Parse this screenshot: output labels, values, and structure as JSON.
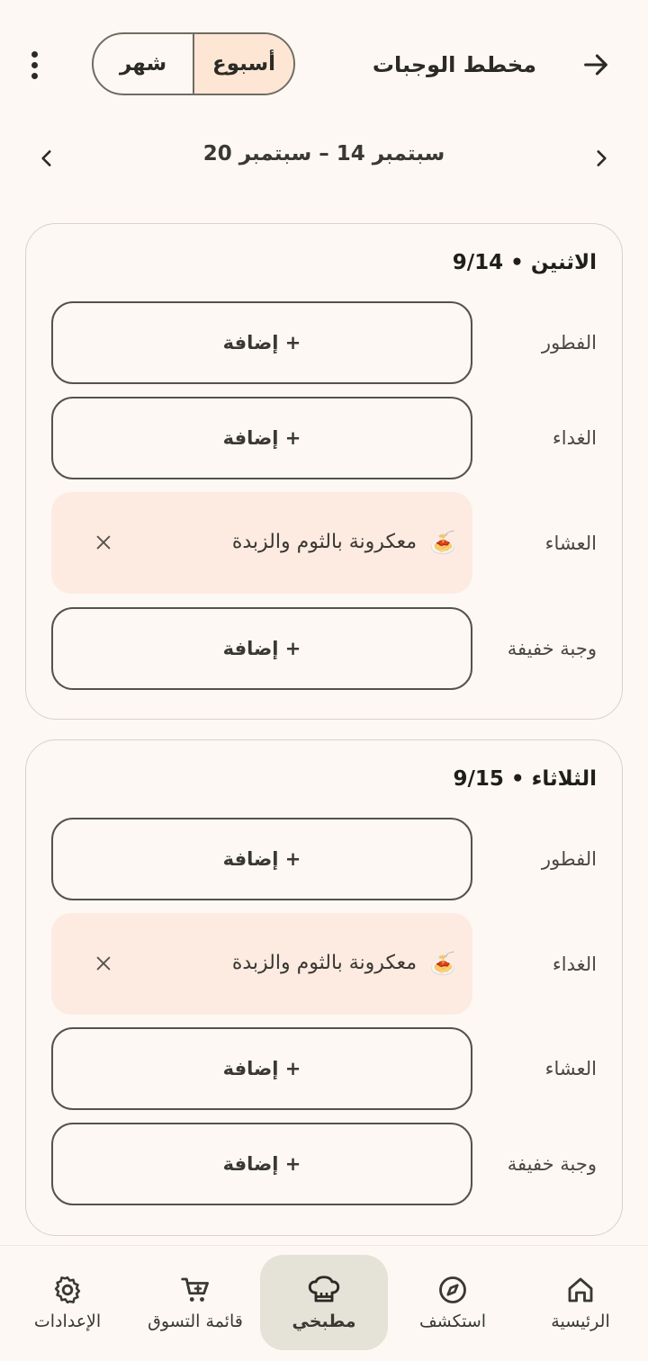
{
  "header": {
    "title": "مخطط الوجبات",
    "segments": [
      "أسبوع",
      "شهر"
    ],
    "active_segment": "أسبوع"
  },
  "week": {
    "range": "سبتمبر 14 – سبتمبر 20"
  },
  "days": [
    {
      "title": "الاثنين • 9/14",
      "meals": [
        {
          "label": "الفطور",
          "state": "empty",
          "action": "+ إضافة"
        },
        {
          "label": "الغداء",
          "state": "empty",
          "action": "+ إضافة"
        },
        {
          "label": "العشاء",
          "state": "filled",
          "emoji": "🍝",
          "name": "معكرونة بالثوم والزبدة"
        },
        {
          "label": "وجبة خفيفة",
          "state": "empty",
          "action": "+ إضافة"
        }
      ]
    },
    {
      "title": "الثلاثاء • 9/15",
      "meals": [
        {
          "label": "الفطور",
          "state": "empty",
          "action": "+ إضافة"
        },
        {
          "label": "الغداء",
          "state": "filled",
          "emoji": "🍝",
          "name": "معكرونة بالثوم والزبدة"
        },
        {
          "label": "العشاء",
          "state": "empty",
          "action": "+ إضافة"
        },
        {
          "label": "وجبة خفيفة",
          "state": "empty",
          "action": "+ إضافة"
        }
      ]
    }
  ],
  "bottom_nav": {
    "items": [
      {
        "label": "الرئيسية",
        "icon": "home-icon"
      },
      {
        "label": "استكشف",
        "icon": "compass-icon"
      },
      {
        "label": "مطبخي",
        "icon": "chef-hat-icon",
        "active": true
      },
      {
        "label": "قائمة التسوق",
        "icon": "cart-icon"
      },
      {
        "label": "الإعدادات",
        "icon": "gear-icon"
      }
    ]
  },
  "colors": {
    "background": "#fdf8f3",
    "segment_active": "#fde6d4",
    "filled_meal": "#fdebe2",
    "nav_active": "#e5e2d7",
    "border": "#55524a"
  }
}
